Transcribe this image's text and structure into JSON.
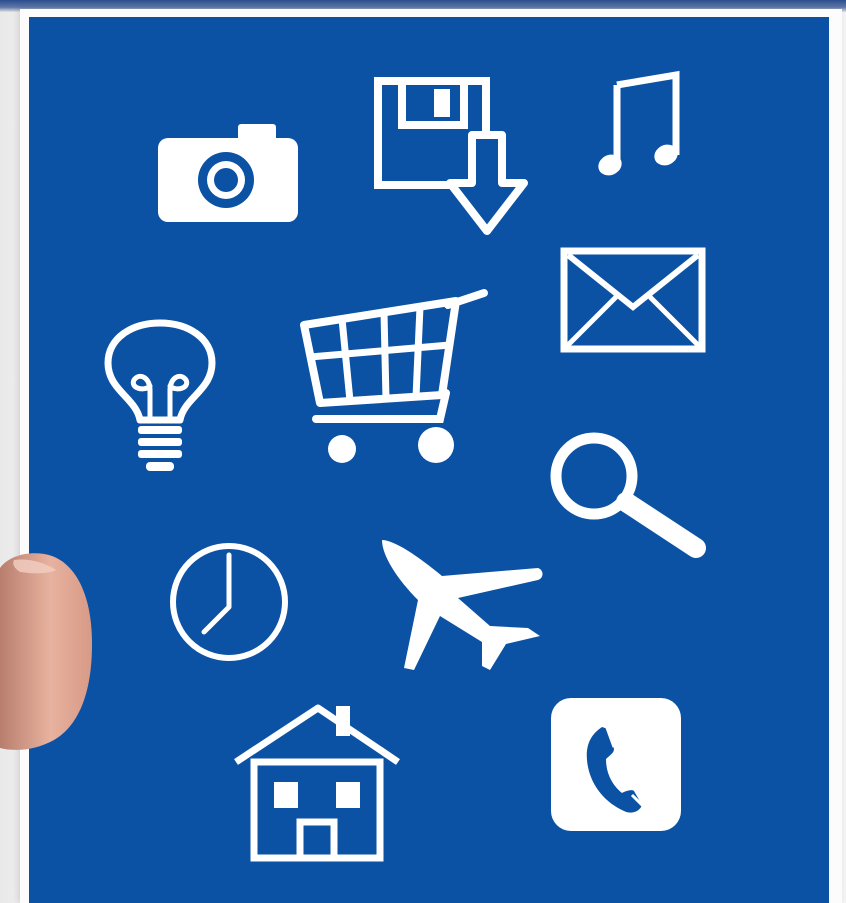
{
  "scene": {
    "subject": "handheld-card",
    "panel_color": "#0b52a5",
    "icon_color": "#ffffff",
    "card_edge_color": "#fcfcfc"
  },
  "icons": [
    {
      "name": "camera-icon"
    },
    {
      "name": "floppy-disk-download-icon"
    },
    {
      "name": "music-note-icon"
    },
    {
      "name": "envelope-icon"
    },
    {
      "name": "lightbulb-icon"
    },
    {
      "name": "shopping-cart-icon"
    },
    {
      "name": "magnifier-icon"
    },
    {
      "name": "clock-icon"
    },
    {
      "name": "airplane-icon"
    },
    {
      "name": "house-icon"
    },
    {
      "name": "phone-icon"
    }
  ]
}
